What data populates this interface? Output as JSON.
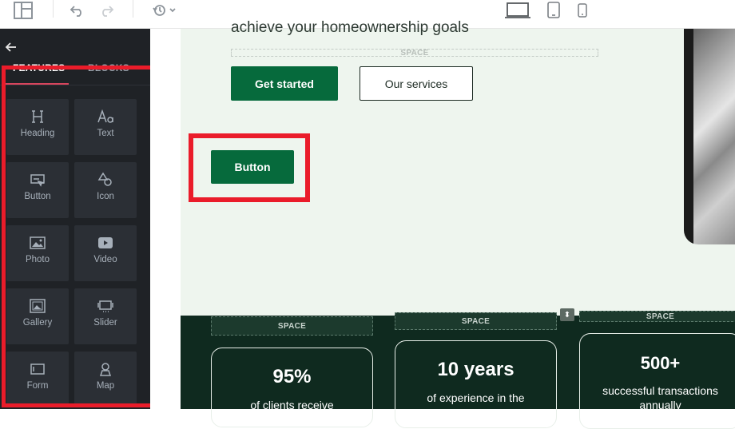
{
  "toolbar": {
    "layout_icon": "layout-icon",
    "undo_icon": "undo-icon",
    "redo_icon": "redo-icon",
    "history_icon": "history-icon",
    "devices": [
      "desktop-icon",
      "tablet-icon",
      "mobile-icon"
    ]
  },
  "sidebar": {
    "back_icon": "arrow-left-icon",
    "tabs": [
      {
        "label": "FEATURES",
        "active": true
      },
      {
        "label": "BLOCKS",
        "active": false
      }
    ],
    "items": [
      {
        "label": "Heading",
        "icon": "heading-icon"
      },
      {
        "label": "Text",
        "icon": "text-icon"
      },
      {
        "label": "Button",
        "icon": "button-icon"
      },
      {
        "label": "Icon",
        "icon": "shapes-icon"
      },
      {
        "label": "Photo",
        "icon": "photo-icon"
      },
      {
        "label": "Video",
        "icon": "video-icon"
      },
      {
        "label": "Gallery",
        "icon": "gallery-icon"
      },
      {
        "label": "Slider",
        "icon": "slider-icon"
      },
      {
        "label": "Form",
        "icon": "form-icon"
      },
      {
        "label": "Map",
        "icon": "map-pin-icon"
      }
    ]
  },
  "canvas": {
    "hero_text": "achieve your homeownership goals",
    "space_label": "SPACE",
    "get_started": "Get started",
    "our_services": "Our services",
    "new_button": "Button",
    "stats": [
      {
        "big": "95%",
        "small": "of clients receive"
      },
      {
        "big": "10 years",
        "small": "of experience in the"
      },
      {
        "big": "500+",
        "small": "successful transactions annually"
      }
    ]
  },
  "colors": {
    "accent_green": "#066a3c",
    "sidebar_bg": "#1f2226",
    "highlight_red": "#ea1c2a",
    "stats_bg": "#0f2a1f"
  }
}
